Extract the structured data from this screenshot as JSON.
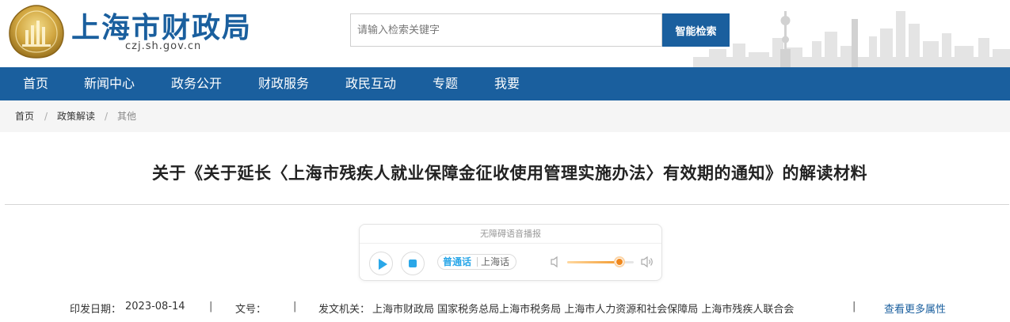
{
  "header": {
    "site_title": "上海市财政局",
    "domain": "czj.sh.gov.cn",
    "search": {
      "placeholder": "请输入检索关键字",
      "button_label": "智能检索"
    }
  },
  "nav": {
    "items": [
      "首页",
      "新闻中心",
      "政务公开",
      "财政服务",
      "政民互动",
      "专题",
      "我要"
    ]
  },
  "breadcrumb": {
    "items": [
      "首页",
      "政策解读"
    ],
    "current": "其他",
    "separator": "/"
  },
  "article": {
    "title": "关于《关于延长〈上海市残疾人就业保障金征收使用管理实施办法〉有效期的通知》的解读材料"
  },
  "audio_player": {
    "label": "无障碍语音播报",
    "languages": [
      "普通话",
      "上海话"
    ],
    "selected_language": "普通话",
    "volume": 0.78
  },
  "meta": {
    "date_label": "印发日期：",
    "date_value": "2023-08-14",
    "doc_no_label": "文号：",
    "doc_no_value": "",
    "issuer_label": "发文机关：",
    "issuer_value": "上海市财政局 国家税务总局上海市税务局 上海市人力资源和社会保障局 上海市残疾人联合会",
    "separator": "|",
    "more_link": "查看更多属性"
  },
  "colors": {
    "brand_blue": "#1a5f9e",
    "player_accent": "#2aa7e8",
    "volume_accent": "#f0871c"
  }
}
